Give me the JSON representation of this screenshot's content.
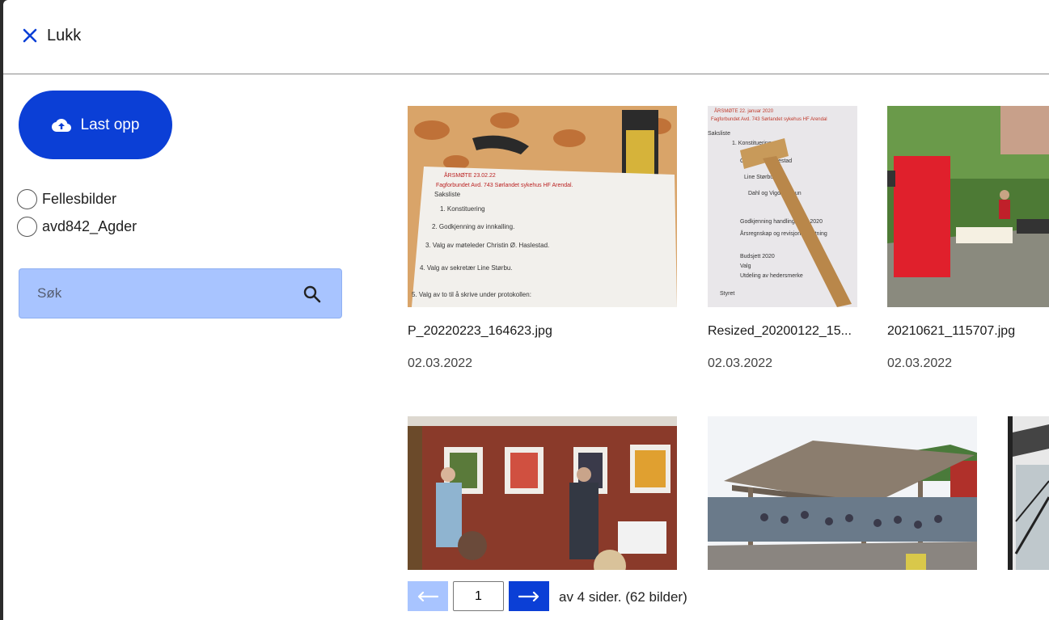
{
  "header": {
    "close_label": "Lukk"
  },
  "sidebar": {
    "upload_label": "Last opp",
    "folders": [
      {
        "label": "Fellesbilder"
      },
      {
        "label": "avd842_Agder"
      }
    ],
    "search": {
      "placeholder": "Søk",
      "value": ""
    }
  },
  "gallery": {
    "items": [
      {
        "filename": "P_20220223_164623.jpg",
        "date": "02.03.2022"
      },
      {
        "filename": "Resized_20200122_15...",
        "date": "02.03.2022"
      },
      {
        "filename": "20210621_115707.jpg",
        "date": "02.03.2022"
      },
      {
        "filename": "",
        "date": ""
      },
      {
        "filename": "",
        "date": ""
      },
      {
        "filename": "",
        "date": ""
      }
    ]
  },
  "pagination": {
    "current_page": "1",
    "summary": "av 4 sider. (62 bilder)"
  },
  "colors": {
    "accent": "#0b3fd6",
    "accent_light": "#a8c4ff"
  }
}
